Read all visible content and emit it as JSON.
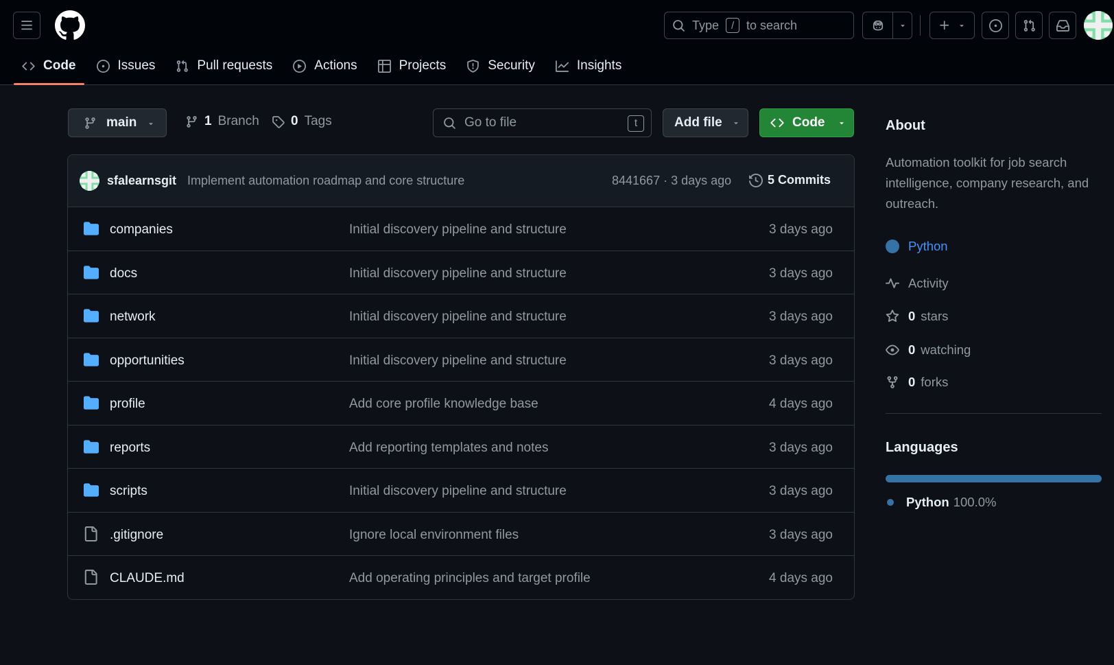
{
  "search": {
    "prefix": "Type",
    "key": "/",
    "suffix": "to search"
  },
  "nav": [
    {
      "label": "Code",
      "icon": "code-icon",
      "active": true
    },
    {
      "label": "Issues",
      "icon": "issue-opened-icon"
    },
    {
      "label": "Pull requests",
      "icon": "git-pull-request-icon"
    },
    {
      "label": "Actions",
      "icon": "play-icon"
    },
    {
      "label": "Projects",
      "icon": "table-icon"
    },
    {
      "label": "Security",
      "icon": "shield-icon"
    },
    {
      "label": "Insights",
      "icon": "graph-icon"
    }
  ],
  "toolbar": {
    "branch": "main",
    "branches_count": "1",
    "branches_label": "Branch",
    "tags_count": "0",
    "tags_label": "Tags",
    "goto_placeholder": "Go to file",
    "goto_key": "t",
    "add_file": "Add file",
    "code": "Code"
  },
  "commit": {
    "author": "sfalearnsgit",
    "message": "Implement automation roadmap and core structure",
    "sha_age": "8441667 · 3 days ago",
    "count": "5 Commits"
  },
  "files": [
    {
      "name": "companies",
      "type": "dir",
      "message": "Initial discovery pipeline and structure",
      "age": "3 days ago"
    },
    {
      "name": "docs",
      "type": "dir",
      "message": "Initial discovery pipeline and structure",
      "age": "3 days ago"
    },
    {
      "name": "network",
      "type": "dir",
      "message": "Initial discovery pipeline and structure",
      "age": "3 days ago"
    },
    {
      "name": "opportunities",
      "type": "dir",
      "message": "Initial discovery pipeline and structure",
      "age": "3 days ago"
    },
    {
      "name": "profile",
      "type": "dir",
      "message": "Add core profile knowledge base",
      "age": "4 days ago"
    },
    {
      "name": "reports",
      "type": "dir",
      "message": "Add reporting templates and notes",
      "age": "3 days ago"
    },
    {
      "name": "scripts",
      "type": "dir",
      "message": "Initial discovery pipeline and structure",
      "age": "3 days ago"
    },
    {
      "name": ".gitignore",
      "type": "file",
      "message": "Ignore local environment files",
      "age": "3 days ago"
    },
    {
      "name": "CLAUDE.md",
      "type": "file",
      "message": "Add operating principles and target profile",
      "age": "4 days ago"
    }
  ],
  "about": {
    "title": "About",
    "description": "Automation toolkit for job search intelligence, company research, and outreach.",
    "language_topic": "Python",
    "activity": "Activity",
    "stars_count": "0",
    "stars_label": "stars",
    "watching_count": "0",
    "watching_label": "watching",
    "forks_count": "0",
    "forks_label": "forks"
  },
  "languages": {
    "title": "Languages",
    "items": [
      {
        "name": "Python",
        "percent": "100.0%",
        "color": "#3572A5"
      }
    ]
  },
  "colors": {
    "background": "#0d1117",
    "header": "#010409",
    "accent_underline": "#f78166",
    "primary_button": "#238636",
    "python": "#3572A5",
    "folder": "#54aeff"
  }
}
